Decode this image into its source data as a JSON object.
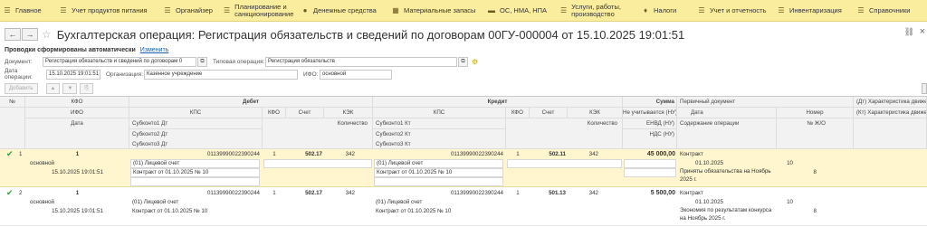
{
  "menu": [
    {
      "label": "Главное",
      "icon": "menu-icon"
    },
    {
      "label": "Учет продуктов питания",
      "icon": "menu-icon"
    },
    {
      "label": "Органайзер",
      "icon": "menu-icon"
    },
    {
      "label": "Планирование и санкционирование",
      "icon": "menu-icon"
    },
    {
      "label": "Денежные средства",
      "icon": "coin-icon"
    },
    {
      "label": "Материальные запасы",
      "icon": "box-icon"
    },
    {
      "label": "ОС, НМА, НПА",
      "icon": "truck-icon"
    },
    {
      "label": "Услуги, работы, производство",
      "icon": "menu-icon"
    },
    {
      "label": "Налоги",
      "icon": "tax-icon"
    },
    {
      "label": "Учет и отчетность",
      "icon": "menu-icon"
    },
    {
      "label": "Инвентаризация",
      "icon": "menu-icon"
    },
    {
      "label": "Справочники",
      "icon": "menu-icon"
    }
  ],
  "header": {
    "back": "←",
    "forward": "→",
    "title": "Бухгалтерская операция: Регистрация обязательств и сведений по договорам 00ГУ-000004 от 15.10.2025 19:01:51",
    "link_icon": "⛓",
    "close": "×"
  },
  "notice": {
    "text": "Проводки сформированы автоматически",
    "link": "Изменить"
  },
  "form": {
    "document_label": "Документ:",
    "document_value": "Регистрация обязательств и сведений по договорам 0",
    "typical_op_label": "Типовая операция:",
    "typical_op_value": "Регистрация обязательств",
    "op_date_label": "Дата операции:",
    "op_date_value": "15.10.2025 19:01:51",
    "org_label": "Организация:",
    "org_value": "Казенное учреждение",
    "ifo_label": "ИФО:",
    "ifo_value": "основной"
  },
  "toolbar": {
    "add": "Добавить",
    "up": "▲",
    "down": "▼",
    "copy": "⎘"
  },
  "grid": {
    "headers": {
      "num": "№",
      "kfo": "КФО",
      "ifo": "ИФО",
      "date": "Дата",
      "debit": "Дебет",
      "credit": "Кредит",
      "kps": "КПС",
      "kfo_small": "КФО",
      "account": "Счет",
      "kek": "КЭК",
      "qty": "Количество",
      "sub1dt": "Субконто1 Дт",
      "sub2dt": "Субконто2 Дт",
      "sub3dt": "Субконто3 Дт",
      "sub1kt": "Субконто1 Кт",
      "sub2kt": "Субконто2 Кт",
      "sub3kt": "Субконто3 Кт",
      "sum": "Сумма",
      "not_included": "Не учитывается (НУ)",
      "envd": "ЕНВД (НУ)",
      "nds": "НДС (НУ)",
      "primary_doc": "Первичный документ",
      "pd_date": "Дата",
      "pd_number": "Номер",
      "pd_content": "Содержание операции",
      "pd_jo": "№ Ж/О",
      "char_dt": "(Дт) Характеристика движе",
      "char_kt": "(Кт) Характеристика движе"
    },
    "rows": [
      {
        "n": "1",
        "kfo": "1",
        "ifo": "основной",
        "date": "15.10.2025 19:01:51",
        "dt_kps": "01139990022390244",
        "dt_kfo": "1",
        "dt_account": "502.17",
        "dt_kek": "342",
        "dt_sub1": "(01) Лицевой счет",
        "dt_sub2": "Контракт от 01.10.2025 № 10",
        "kt_kps": "01139990022390244",
        "kt_kfo": "1",
        "kt_account": "502.11",
        "kt_kek": "342",
        "kt_sub1": "(01) Лицевой счет",
        "kt_sub2": "Контракт от 01.10.2025 № 10",
        "sum": "45 000,00",
        "pd_doc": "Контракт",
        "pd_date": "01.10.2025",
        "pd_number": "10",
        "pd_content": "Приняты обязательства на Ноябрь 2025 г.",
        "pd_jo": "8"
      },
      {
        "n": "2",
        "kfo": "1",
        "ifo": "основной",
        "date": "15.10.2025 19:01:51",
        "dt_kps": "01139990022390244",
        "dt_kfo": "1",
        "dt_account": "502.17",
        "dt_kek": "342",
        "dt_sub1": "(01) Лицевой счет",
        "dt_sub2": "Контракт от 01.10.2025 № 10",
        "kt_kps": "01139990022390244",
        "kt_kfo": "1",
        "kt_account": "501.13",
        "kt_kek": "342",
        "kt_sub1": "(01) Лицевой счет",
        "kt_sub2": "Контракт от 01.10.2025 № 10",
        "sum": "5 500,00",
        "pd_doc": "Контракт",
        "pd_date": "01.10.2025",
        "pd_number": "10",
        "pd_content": "Экономия по результатам конкурса на Ноябрь 2025 г.",
        "pd_jo": "8"
      }
    ]
  }
}
